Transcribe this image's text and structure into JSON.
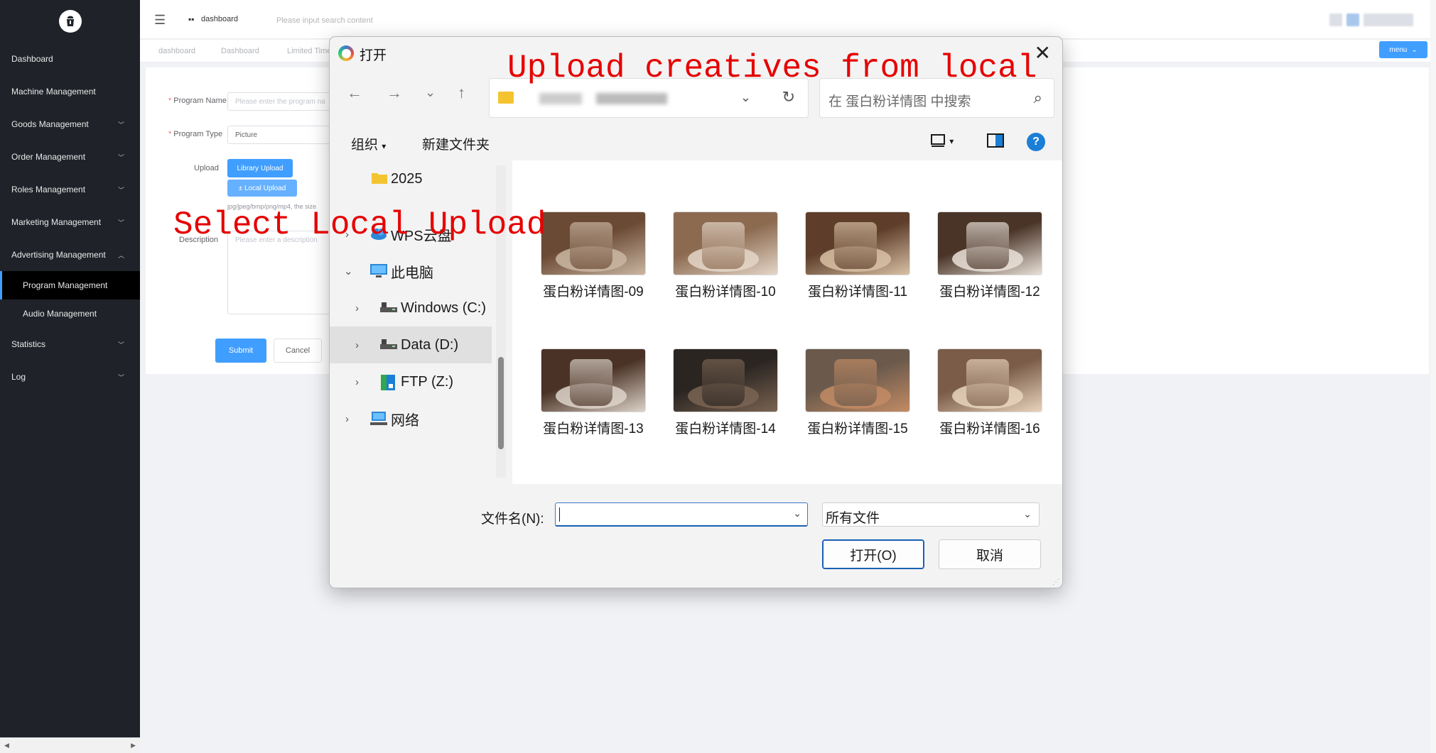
{
  "sidebar": {
    "items": [
      {
        "label": "Dashboard",
        "has_children": false
      },
      {
        "label": "Machine Management",
        "has_children": false
      },
      {
        "label": "Goods Management",
        "has_children": true
      },
      {
        "label": "Order Management",
        "has_children": true
      },
      {
        "label": "Roles Management",
        "has_children": true
      },
      {
        "label": "Marketing Management",
        "has_children": true
      },
      {
        "label": "Advertising Management",
        "has_children": true,
        "expanded": true
      }
    ],
    "subitems": [
      {
        "label": "Program Management",
        "active": true
      },
      {
        "label": "Audio Management",
        "active": false
      }
    ],
    "items_after": [
      {
        "label": "Statistics",
        "has_children": true
      },
      {
        "label": "Log",
        "has_children": true
      }
    ],
    "scroll_left": "◀",
    "scroll_right": "▶"
  },
  "topbar": {
    "hamburger": "☰",
    "dash_icon": "▪▪",
    "dashboard_label": "dashboard",
    "search_placeholder": "Please input search content"
  },
  "tabs": {
    "items": [
      "dashboard",
      "Dashboard",
      "Limited Time"
    ],
    "menu_label": "menu",
    "menu_chevron": "⌄"
  },
  "form": {
    "program_name_label": "Program Name",
    "program_name_placeholder": "Please enter the program na",
    "program_type_label": "Program Type",
    "program_type_value": "Picture",
    "upload_label": "Upload",
    "library_upload": "Library Upload",
    "local_upload": "± Local Upload",
    "upload_hint": "jpg/jpeg/bmp/png/mp4, the size",
    "description_label": "Description",
    "description_placeholder": "Please enter a description",
    "submit": "Submit",
    "cancel": "Cancel",
    "required_mark": "*"
  },
  "annotations": {
    "top": "Upload creatives from local",
    "left": "Select Local Upload"
  },
  "dialog": {
    "title": "打开",
    "close": "✕",
    "nav": {
      "back": "←",
      "forward": "→",
      "recent": "⌄",
      "up": "↑"
    },
    "address_dropdown": "⌄",
    "refresh": "↻",
    "search_placeholder": "在 蛋白粉详情图 中搜索",
    "search_icon": "⌕",
    "toolbar": {
      "organize": "组织",
      "organize_arrow": "▾",
      "new_folder": "新建文件夹",
      "view_arrow": "▾",
      "help": "?"
    },
    "tree": [
      {
        "label": "2025",
        "icon": "folder-icon"
      },
      {
        "label": "WPS云盘",
        "icon": "cloud-icon"
      },
      {
        "label": "此电脑",
        "icon": "computer-icon"
      },
      {
        "label": "Windows (C:)",
        "icon": "drive-icon"
      },
      {
        "label": "Data (D:)",
        "icon": "drive-icon"
      },
      {
        "label": "FTP (Z:)",
        "icon": "network-drive-icon"
      },
      {
        "label": "网络",
        "icon": "network-icon"
      }
    ],
    "tree_chevrons": {
      "collapsed": "›",
      "expanded": "⌄"
    },
    "files": [
      {
        "name": "蛋白粉详情图-09",
        "colors": [
          "#6b4a35",
          "#c9b6a2"
        ]
      },
      {
        "name": "蛋白粉详情图-10",
        "colors": [
          "#8c6a50",
          "#e4d6c8"
        ]
      },
      {
        "name": "蛋白粉详情图-11",
        "colors": [
          "#5e3e2a",
          "#d8c1a4"
        ]
      },
      {
        "name": "蛋白粉详情图-12",
        "colors": [
          "#4a3428",
          "#e9e1d8"
        ]
      },
      {
        "name": "蛋白粉详情图-13",
        "colors": [
          "#4a3226",
          "#ddd3c9"
        ]
      },
      {
        "name": "蛋白粉详情图-14",
        "colors": [
          "#2b2522",
          "#7a6452"
        ]
      },
      {
        "name": "蛋白粉详情图-15",
        "colors": [
          "#6b5a4c",
          "#c28b64"
        ]
      },
      {
        "name": "蛋白粉详情图-16",
        "colors": [
          "#7a5c48",
          "#e8d3bd"
        ]
      }
    ],
    "filename_label": "文件名(N):",
    "filename_value": "",
    "filename_dropdown": "⌄",
    "filter_value": "所有文件",
    "filter_dropdown": "⌄",
    "open_button": "打开(O)",
    "cancel_button": "取消",
    "grip": "⋰"
  }
}
